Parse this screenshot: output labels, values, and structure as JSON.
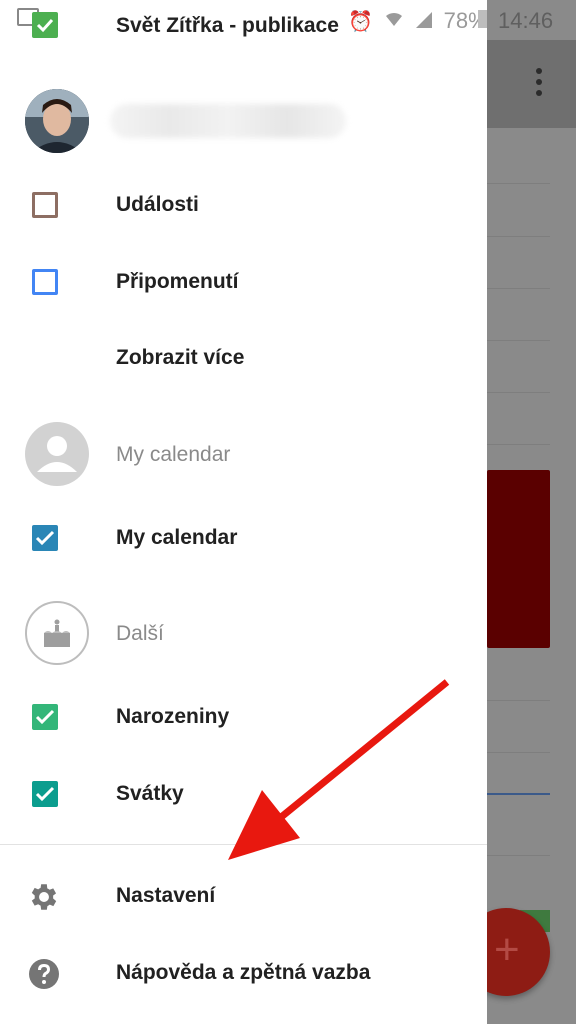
{
  "status_bar": {
    "notification_title": "Svět Zítřka - publikace",
    "icons": [
      "alarm-icon",
      "wifi-icon",
      "signal-icon"
    ],
    "battery": "78%",
    "time": "14:46"
  },
  "account": {
    "avatar": "user-photo"
  },
  "drawer": {
    "items": [
      {
        "label": "Události",
        "type": "checkbox",
        "checked": false,
        "color": "#8d6e63"
      },
      {
        "label": "Připomenutí",
        "type": "checkbox",
        "checked": false,
        "color": "#4285f4"
      },
      {
        "label": "Zobrazit více",
        "type": "action"
      }
    ],
    "groups": [
      {
        "header": "My calendar",
        "icon": "person-icon",
        "calendars": [
          {
            "label": "My calendar",
            "checked": true,
            "color": "#2a86b6"
          }
        ]
      },
      {
        "header": "Další",
        "icon": "birthday-cake-icon",
        "calendars": [
          {
            "label": "Narozeniny",
            "checked": true,
            "color": "#33b679"
          },
          {
            "label": "Svátky",
            "checked": true,
            "color": "#0b9d8e"
          }
        ]
      }
    ],
    "footer": [
      {
        "label": "Nastavení",
        "icon": "gear-icon"
      },
      {
        "label": "Nápověda a zpětná vazba",
        "icon": "help-icon"
      }
    ]
  },
  "fab": {
    "symbol": "+",
    "icon": "add-icon"
  },
  "colors": {
    "annotation_arrow": "#e8180f",
    "scrim": "#8a8a8a",
    "event_block": "#5a0000"
  }
}
